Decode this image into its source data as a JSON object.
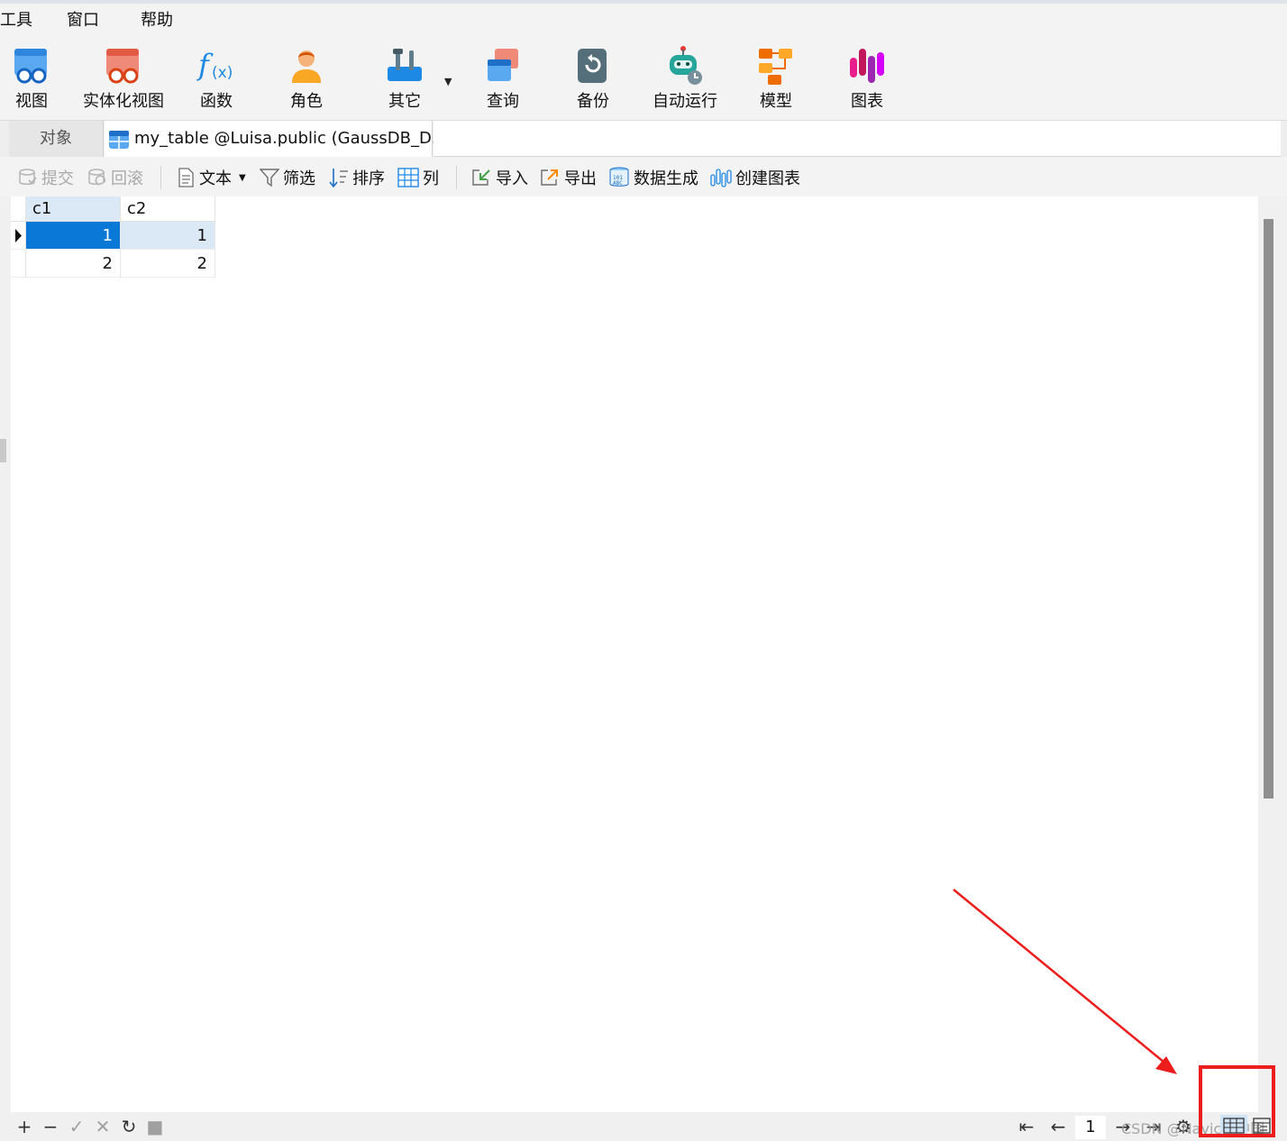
{
  "menu": {
    "items": [
      "工具",
      "窗口",
      "帮助"
    ]
  },
  "ribbon": {
    "items": [
      {
        "label": "视图",
        "icon": "view-icon"
      },
      {
        "label": "实体化视图",
        "icon": "materialized-view-icon"
      },
      {
        "label": "函数",
        "icon": "function-icon"
      },
      {
        "label": "角色",
        "icon": "role-icon"
      },
      {
        "label": "其它",
        "icon": "others-icon"
      },
      {
        "label": "查询",
        "icon": "query-icon"
      },
      {
        "label": "备份",
        "icon": "backup-icon"
      },
      {
        "label": "自动运行",
        "icon": "automation-icon"
      },
      {
        "label": "模型",
        "icon": "model-icon"
      },
      {
        "label": "图表",
        "icon": "chart-icon"
      }
    ]
  },
  "tabs": {
    "objects": "对象",
    "active": "my_table @Luisa.public (GaussDB_D..."
  },
  "toolbar": {
    "commit": "提交",
    "rollback": "回滚",
    "text": "文本",
    "filter": "筛选",
    "sort": "排序",
    "columns": "列",
    "import": "导入",
    "export": "导出",
    "generate_data": "数据生成",
    "create_chart": "创建图表"
  },
  "grid": {
    "columns": [
      "c1",
      "c2"
    ],
    "rows": [
      [
        "1",
        "1"
      ],
      [
        "2",
        "2"
      ]
    ]
  },
  "status": {
    "page": "1",
    "watermark": "CSDN @Navicat中国"
  },
  "colors": {
    "selection": "#0a78d7",
    "selection_light": "#dbe9f7",
    "annotation_red": "#ee1d1d"
  }
}
